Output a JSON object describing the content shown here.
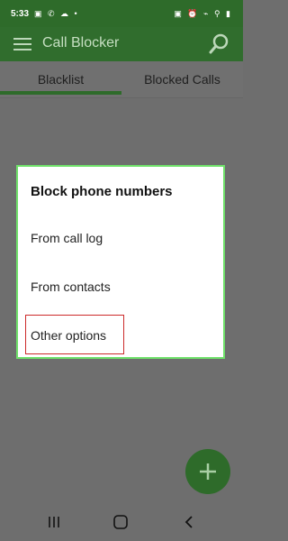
{
  "status_bar": {
    "time": "5:33",
    "left_icons": "▣ ✆ ☁ •",
    "right_icons": "▣ ⏰ ⌁ ⚲ ▮"
  },
  "toolbar": {
    "title": "Call Blocker"
  },
  "tabs": [
    {
      "label": "Blacklist",
      "selected": true
    },
    {
      "label": "Blocked Calls",
      "selected": false
    }
  ],
  "dialog": {
    "title": "Block phone numbers",
    "options": [
      {
        "label": "From call log"
      },
      {
        "label": "From contacts"
      },
      {
        "label": "Other options"
      }
    ]
  },
  "colors": {
    "primary": "#2e6b2a",
    "dialog_border": "#6fe16a",
    "highlight": "#cc2a2a"
  }
}
